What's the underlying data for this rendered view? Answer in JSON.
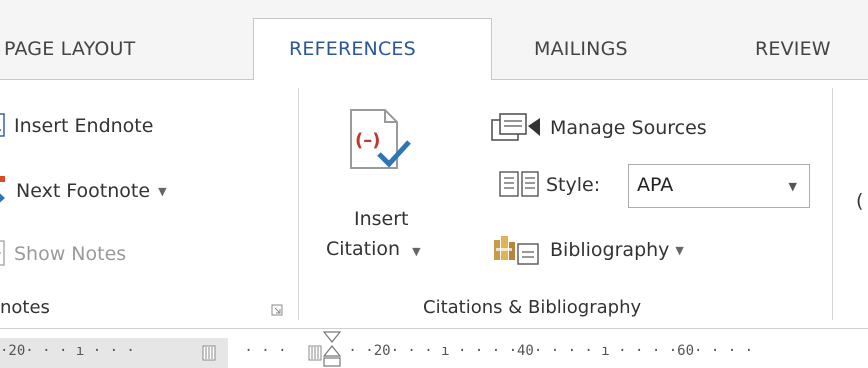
{
  "tabs": {
    "page_layout": "PAGE LAYOUT",
    "references": "REFERENCES",
    "mailings": "MAILINGS",
    "review": "REVIEW"
  },
  "footnotes": {
    "insert_endnote": "Insert Endnote",
    "next_footnote": "Next Footnote",
    "show_notes": "Show Notes",
    "group_label": "notes"
  },
  "citations": {
    "insert_citation_line1": "Insert",
    "insert_citation_line2": "Citation",
    "manage_sources": "Manage Sources",
    "style_label": "Style:",
    "style_value": "APA",
    "bibliography": "Bibliography",
    "group_label": "Citations & Bibliography"
  },
  "ruler": {
    "left_text": "·20· · · ı · · · ",
    "mid_text": " · · · ",
    "right_text": " · ·20· · · ı · · · ·40· · · · ı · · · ·60· · · ·"
  },
  "colors": {
    "accent": "#2b579a",
    "tab_strip": "#f5f5f5",
    "citation_red": "#c0392b",
    "check_blue": "#2e75b6"
  }
}
